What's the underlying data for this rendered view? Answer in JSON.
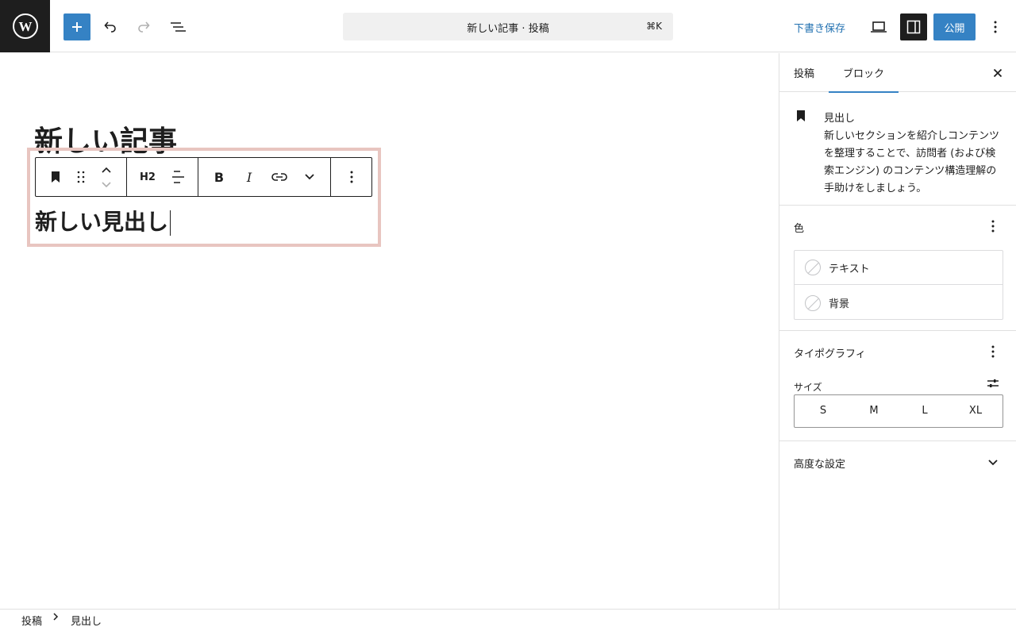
{
  "topbar": {
    "logo": "wordpress-logo",
    "add_icon": "plus-icon",
    "undo_icon": "undo-icon",
    "redo_icon": "redo-icon",
    "list_view_icon": "list-view-icon",
    "command_title": "新しい記事 · 投稿",
    "command_shortcut": "⌘K",
    "save_draft": "下書き保存",
    "view_icon": "desktop-icon",
    "settings_icon": "sidebar-icon",
    "publish": "公開",
    "more_icon": "ellipsis-vertical-icon",
    "accent": "#3582c4"
  },
  "editor": {
    "post_title": "新しい記事",
    "heading_block_text": "新しい見出し",
    "toolbar": {
      "block_icon": "bookmark-icon",
      "drag_icon": "drag-handle-icon",
      "move_up_icon": "chevron-up-icon",
      "move_down_icon": "chevron-down-icon",
      "heading_level": "H2",
      "align_icon": "align-left-icon",
      "bold_icon": "bold-icon",
      "italic_icon": "italic-icon",
      "link_icon": "link-icon",
      "more_format_icon": "chevron-down-icon",
      "options_icon": "ellipsis-vertical-icon"
    }
  },
  "sidebar": {
    "tabs": [
      {
        "label": "投稿"
      },
      {
        "label": "ブロック"
      }
    ],
    "active_tab": "ブロック",
    "block_card": {
      "name": "見出し",
      "description": "新しいセクションを紹介しコンテンツを整理することで、訪問者 (および検索エンジン) のコンテンツ構造理解の手助けをしましょう。"
    },
    "color_panel": {
      "title": "色",
      "items": [
        {
          "label": "テキスト"
        },
        {
          "label": "背景"
        }
      ]
    },
    "typography_panel": {
      "title": "タイポグラフィ",
      "size_label": "サイズ",
      "sizes": [
        "S",
        "M",
        "L",
        "XL"
      ]
    },
    "advanced_panel": {
      "title": "高度な設定"
    }
  },
  "footer": {
    "breadcrumb": [
      "投稿",
      "見出し"
    ]
  }
}
